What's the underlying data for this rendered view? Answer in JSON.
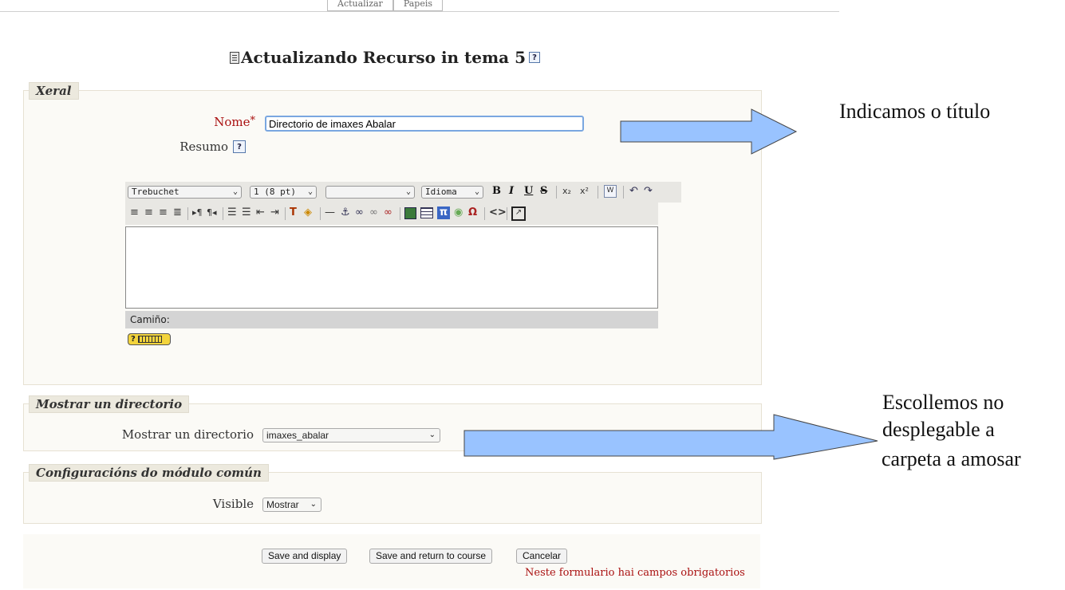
{
  "top_tabs": [
    "Actualizar",
    "Papeis"
  ],
  "page": {
    "title": "Actualizando Recurso in tema 5",
    "help": "?"
  },
  "general": {
    "legend": "Xeral",
    "name_label": "Nome",
    "required_mark": "*",
    "name_value": "Directorio de imaxes Abalar",
    "summary_label": "Resumo",
    "help": "?"
  },
  "editor": {
    "font": "Trebuchet",
    "size": "1 (8 pt)",
    "style": "",
    "language": "Idioma",
    "bold": "B",
    "italic": "I",
    "underline": "U",
    "strike": "S",
    "subscript": "x₂",
    "superscript": "x²",
    "path_label": "Camiño:",
    "keyboard_help": "?",
    "row1_icons": [
      "paste-word-icon",
      "undo-icon",
      "redo-icon"
    ],
    "row2_icons": [
      "align-left-icon",
      "align-center-icon",
      "align-right-icon",
      "justify-icon",
      "ltr-icon",
      "rtl-icon",
      "ordered-list-icon",
      "unordered-list-icon",
      "outdent-icon",
      "indent-icon",
      "text-color-icon",
      "background-color-icon",
      "horizontal-rule-icon",
      "anchor-icon",
      "link-icon",
      "unlink-icon",
      "nolink-icon",
      "image-icon",
      "table-icon",
      "tex-icon",
      "smiley-icon",
      "special-char-icon",
      "html-source-icon",
      "fullscreen-icon"
    ]
  },
  "directory": {
    "legend": "Mostrar un directorio",
    "label": "Mostrar un directorio",
    "value": "imaxes_abalar"
  },
  "common": {
    "legend": "Configuracións do módulo común",
    "visible_label": "Visible",
    "visible_value": "Mostrar"
  },
  "buttons": {
    "save_display": "Save and display",
    "save_return": "Save and return to course",
    "cancel": "Cancelar"
  },
  "required_note": "Neste formulario hai campos obrigatorios",
  "annotations": {
    "title_hint": "Indicamos o título",
    "folder_hint_1": "Escollemos no",
    "folder_hint_2": "desplegable a",
    "folder_hint_3": "carpeta a amosar"
  },
  "colors": {
    "arrow_fill": "#99c3ff",
    "required": "#aa1111",
    "legend_bg": "#ece9de",
    "section_bg": "#fbfaf6"
  }
}
